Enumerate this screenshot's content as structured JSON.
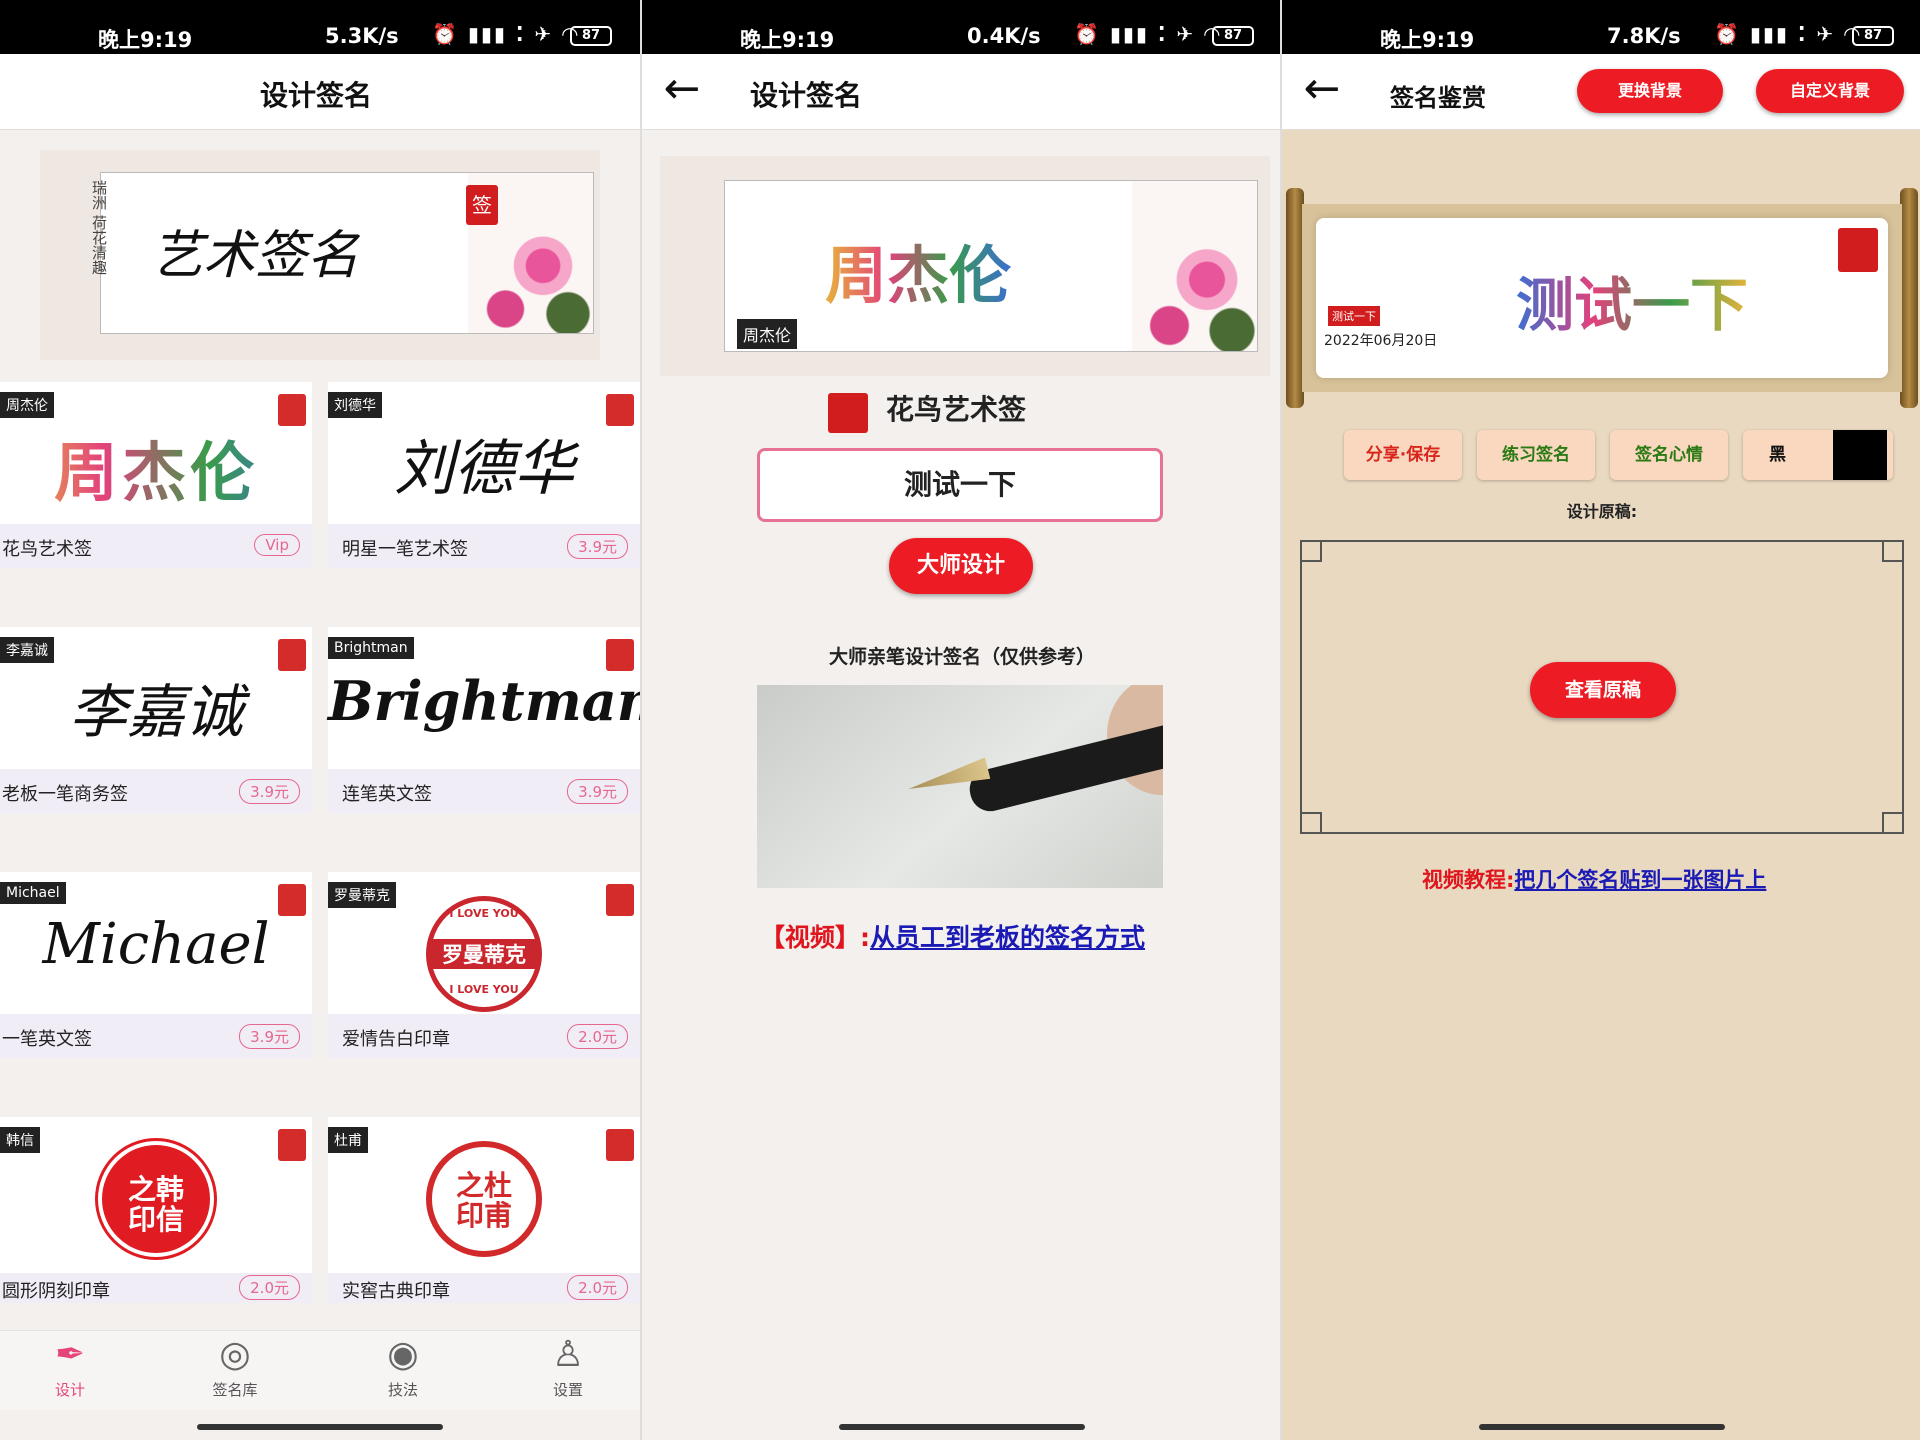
{
  "status_bars": [
    {
      "time": "晚上9:19",
      "net": "5.3K/s",
      "icons": "⏰ ▮▮▮ ⁚ ✈ ◠",
      "battery": "87"
    },
    {
      "time": "晚上9:19",
      "net": "0.4K/s",
      "icons": "⏰ ▮▮▮ ⁚ ✈ ◠",
      "battery": "87"
    },
    {
      "time": "晚上9:19",
      "net": "7.8K/s",
      "icons": "⏰ ▮▮▮ ⁚ ✈ ◠",
      "battery": "87"
    }
  ],
  "screen1": {
    "title": "设计签名",
    "banner_sign": "艺术签名",
    "banner_side": "瑞洲 荷花清趣",
    "banner_seal": "签",
    "cards": [
      {
        "tag": "周杰伦",
        "art": "周杰伦",
        "name": "花鸟艺术签",
        "price": "Vip"
      },
      {
        "tag": "刘德华",
        "art": "刘德华",
        "name": "明星一笔艺术签",
        "price": "3.9元"
      },
      {
        "tag": "李嘉诚",
        "art": "李嘉诚",
        "name": "老板一笔商务签",
        "price": "3.9元"
      },
      {
        "tag": "Brightman",
        "art": "Brightman",
        "name": "连笔英文签",
        "price": "3.9元"
      },
      {
        "tag": "Michael",
        "art": "Michael",
        "name": "一笔英文签",
        "price": "3.9元"
      },
      {
        "tag": "罗曼蒂克",
        "art": "罗曼蒂克",
        "art_top": "I LOVE YOU",
        "art_bottom": "I LOVE YOU",
        "name": "爱情告白印章",
        "price": "2.0元"
      },
      {
        "tag": "韩信",
        "art": "之韩 印信",
        "name": "圆形阴刻印章",
        "price": "2.0元"
      },
      {
        "tag": "杜甫",
        "art": "之杜 印甫",
        "name": "实窖古典印章",
        "price": "2.0元"
      }
    ],
    "tabs": [
      {
        "label": "设计",
        "icon": "✒"
      },
      {
        "label": "签名库",
        "icon": "◎"
      },
      {
        "label": "技法",
        "icon": "◉"
      },
      {
        "label": "设置",
        "icon": "♙"
      }
    ]
  },
  "screen2": {
    "title": "设计签名",
    "back_icon": "←",
    "banner_name_tag": "周杰伦",
    "banner_sign": "周杰伦",
    "style_title": "花鸟艺术签",
    "input_value": "测试一下",
    "master_button": "大师设计",
    "caption": "大师亲笔设计签名（仅供参考）",
    "video_prefix": "【视频】:",
    "video_link": "从员工到老板的签名方式"
  },
  "screen3": {
    "title": "签名鉴赏",
    "back_icon": "←",
    "btn_change_bg": "更换背景",
    "btn_custom_bg": "自定义背景",
    "scroll_sign": "测试一下",
    "scroll_tag": "测试一下",
    "scroll_date": "2022年06月20日",
    "chips": [
      {
        "label": "分享·保存",
        "color": "#d9251c"
      },
      {
        "label": "练习签名",
        "color": "#2c7a14"
      },
      {
        "label": "签名心情",
        "color": "#2c7a14"
      },
      {
        "label": "黑",
        "color": "#111111"
      }
    ],
    "draft_label": "设计原稿:",
    "view_draft_button": "查看原稿",
    "tutorial_prefix": "视频教程:",
    "tutorial_link": "把几个签名贴到一张图片上"
  }
}
